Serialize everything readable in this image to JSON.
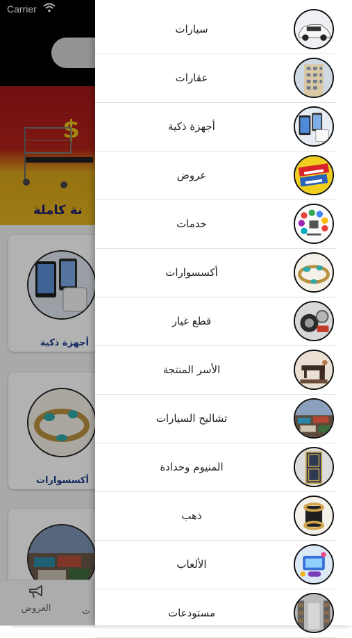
{
  "status_bar": {
    "carrier": "Carrier",
    "wifi_icon": "wifi-icon"
  },
  "background": {
    "banner_text": "نة كاملة",
    "cards": [
      {
        "label": "أجهزة ذكية",
        "icon": "smart-devices-image"
      },
      {
        "label": "أكسسوارات",
        "icon": "accessories-image"
      },
      {
        "label": "",
        "icon": "cars-scrap-image"
      }
    ],
    "tabbar": {
      "offers_label": "العروض",
      "offers_icon": "megaphone-icon",
      "other_label": "ت"
    }
  },
  "drawer": {
    "items": [
      {
        "label": "سيارات",
        "icon": "car-image",
        "color": "#c9ccd2"
      },
      {
        "label": "عقارات",
        "icon": "building-image",
        "color": "#c9b79a"
      },
      {
        "label": "أجهزة ذكية",
        "icon": "smartphones-image",
        "color": "#8aa6c8"
      },
      {
        "label": "عروض",
        "icon": "offers-image",
        "color": "#e6c622"
      },
      {
        "label": "خدمات",
        "icon": "services-image",
        "color": "#f2f2f2"
      },
      {
        "label": "أكسسوارات",
        "icon": "bracelet-image",
        "color": "#d8c49a"
      },
      {
        "label": "قطع غيار",
        "icon": "spare-parts-image",
        "color": "#9a9a9a"
      },
      {
        "label": "الأسر المنتجة",
        "icon": "sewing-machine-image",
        "color": "#b39880"
      },
      {
        "label": "تشاليح السيارات",
        "icon": "scrap-cars-image",
        "color": "#8a6f5a"
      },
      {
        "label": "المنيوم وحدادة",
        "icon": "aluminium-door-image",
        "color": "#4b5a72"
      },
      {
        "label": "ذهب",
        "icon": "gold-ring-image",
        "color": "#d5b06a"
      },
      {
        "label": "الألعاب",
        "icon": "games-image",
        "color": "#7fb3e8"
      },
      {
        "label": "مستودعات",
        "icon": "warehouse-image",
        "color": "#8d8d8d"
      }
    ]
  }
}
